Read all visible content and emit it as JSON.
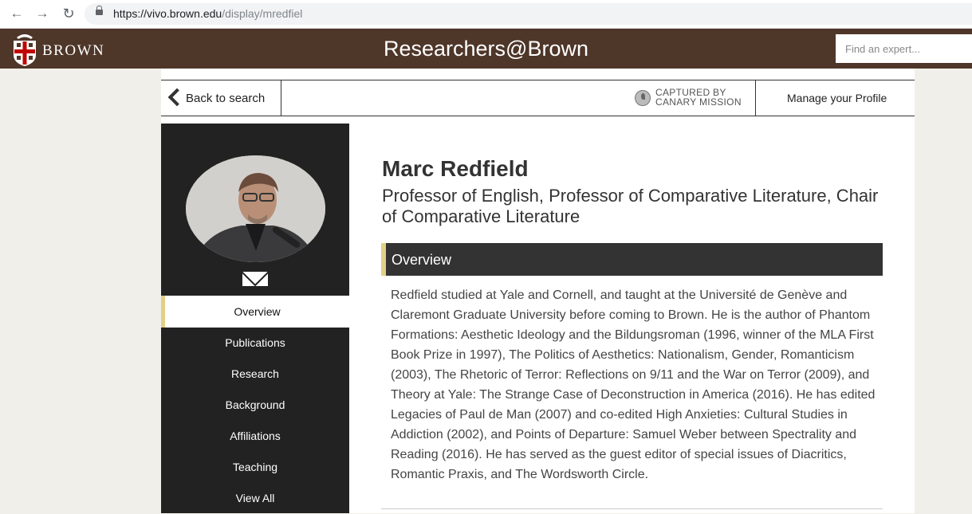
{
  "browser": {
    "url_host": "https://vivo.brown.edu",
    "url_path": "/display/mredfiel",
    "back_icon": "arrow-left-icon",
    "forward_icon": "arrow-right-icon",
    "reload_icon": "reload-icon"
  },
  "header": {
    "logo_text": "BROWN",
    "site_title": "Researchers@Brown",
    "search_placeholder": "Find an expert...",
    "brand_color": "#4e3629"
  },
  "subnav": {
    "back_label": "Back to search",
    "canary_line1": "CAPTURED BY",
    "canary_line2": "CANARY MISSION",
    "manage_label": "Manage your Profile"
  },
  "sidebar": {
    "menu": [
      "Overview",
      "Publications",
      "Research",
      "Background",
      "Affiliations",
      "Teaching",
      "View All"
    ],
    "active_index": 0,
    "accent_color": "#e3cf85"
  },
  "profile": {
    "name": "Marc Redfield",
    "title": "Professor of English, Professor of Comparative Literature, Chair of Comparative Literature"
  },
  "overview": {
    "heading": "Overview",
    "text": "Redfield studied at Yale and Cornell, and taught at the Université de Genève and Claremont Graduate University before coming to Brown. He is the author of Phantom Formations: Aesthetic Ideology and the Bildungsroman (1996, winner of the MLA First Book Prize in 1997), The Politics of Aesthetics: Nationalism, Gender, Romanticism (2003), The Rhetoric of Terror: Reflections on 9/11 and the War on Terror (2009), and Theory at Yale: The Strange Case of Deconstruction in America (2016). He has edited Legacies of Paul de Man (2007) and co-edited High Anxieties: Cultural Studies in Addiction (2002), and Points of Departure: Samuel Weber between Spectrality and Reading (2016).  He has served as the guest editor of special issues of Diacritics, Romantic Praxis, and The Wordsworth Circle."
  }
}
